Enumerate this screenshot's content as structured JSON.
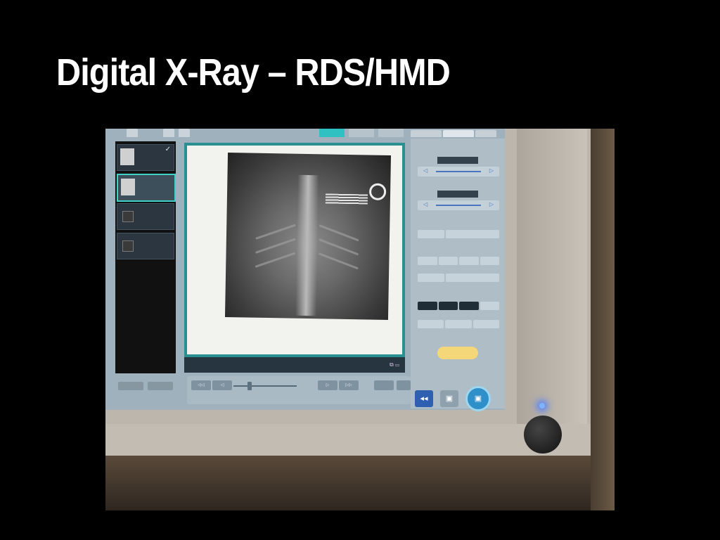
{
  "slide": {
    "title": "Digital X-Ray – RDS/HMD"
  }
}
